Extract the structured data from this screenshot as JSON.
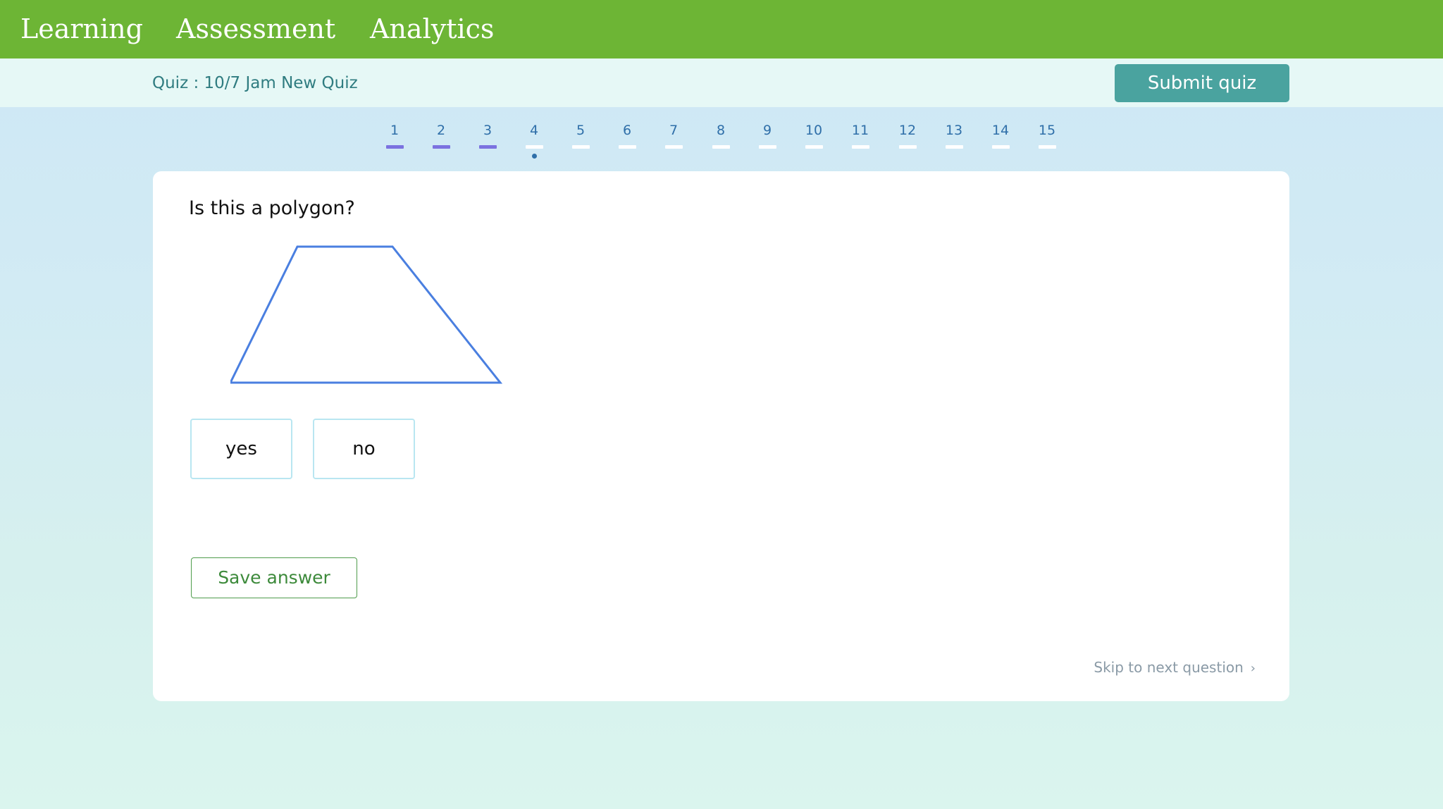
{
  "nav": {
    "items": [
      {
        "label": "Learning"
      },
      {
        "label": "Assessment"
      },
      {
        "label": "Analytics"
      }
    ],
    "background": "#6db535"
  },
  "quiz": {
    "title": "Quiz : 10/7 Jam New Quiz",
    "submit_label": "Submit quiz",
    "submit_color": "#4aa39f"
  },
  "question_nav": {
    "current": 4,
    "items": [
      {
        "number": "1",
        "answered": true
      },
      {
        "number": "2",
        "answered": true
      },
      {
        "number": "3",
        "answered": true
      },
      {
        "number": "4",
        "answered": false
      },
      {
        "number": "5",
        "answered": false
      },
      {
        "number": "6",
        "answered": false
      },
      {
        "number": "7",
        "answered": false
      },
      {
        "number": "8",
        "answered": false
      },
      {
        "number": "9",
        "answered": false
      },
      {
        "number": "10",
        "answered": false
      },
      {
        "number": "11",
        "answered": false
      },
      {
        "number": "12",
        "answered": false
      },
      {
        "number": "13",
        "answered": false
      },
      {
        "number": "14",
        "answered": false
      },
      {
        "number": "15",
        "answered": false
      }
    ],
    "answered_color": "#7b72e0",
    "unanswered_color": "#ffffff"
  },
  "question": {
    "text": "Is this a polygon?",
    "figure": "trapezoid-outline",
    "figure_color": "#4a7fe0",
    "choices": [
      {
        "label": "yes"
      },
      {
        "label": "no"
      }
    ],
    "save_label": "Save answer",
    "skip_label": "Skip to next question",
    "skip_icon": "chevron-right-icon"
  }
}
